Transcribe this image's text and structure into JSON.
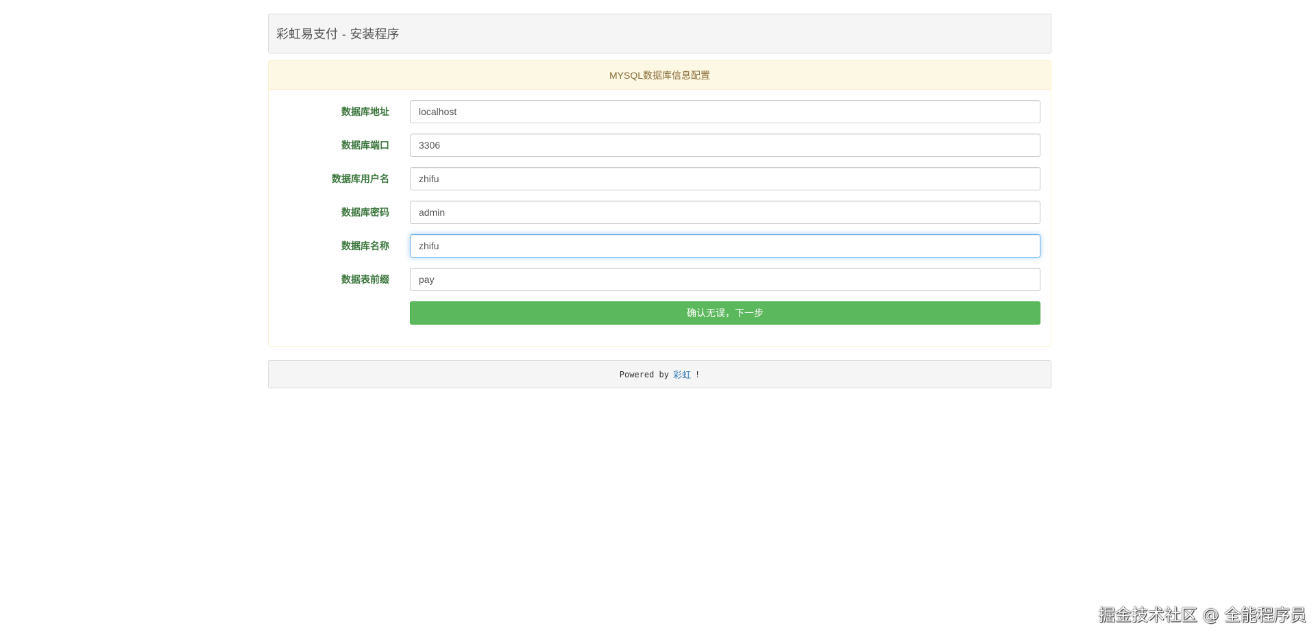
{
  "header": {
    "title": "彩虹易支付 - 安装程序"
  },
  "config": {
    "heading": "MYSQL数据库信息配置",
    "fields": [
      {
        "label": "数据库地址",
        "value": "localhost"
      },
      {
        "label": "数据库端口",
        "value": "3306"
      },
      {
        "label": "数据库用户名",
        "value": "zhifu"
      },
      {
        "label": "数据库密码",
        "value": "admin"
      },
      {
        "label": "数据库名称",
        "value": "zhifu"
      },
      {
        "label": "数据表前缀",
        "value": "pay"
      }
    ],
    "submit_label": "确认无误，下一步"
  },
  "footer": {
    "prefix": "Powered by",
    "link_text": "彩虹",
    "suffix": "!"
  },
  "watermark": {
    "text": "掘金技术社区 @ 全能程序员"
  },
  "colors": {
    "label_green": "#3c763d",
    "heading_bg": "#fcf8e3",
    "heading_text": "#8a6d3b",
    "button_green": "#5cb85c",
    "link_blue": "#337ab7"
  }
}
